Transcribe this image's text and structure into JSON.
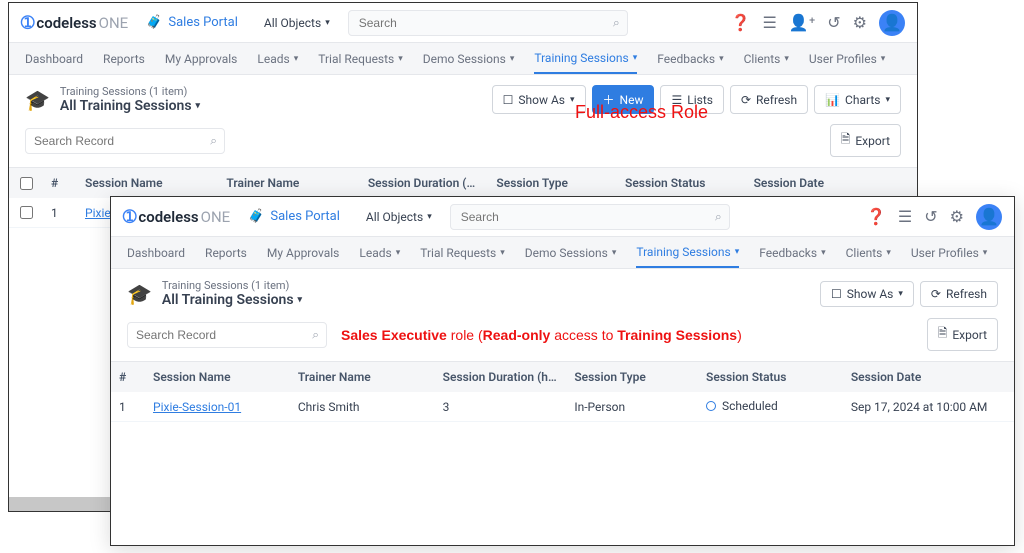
{
  "brand": {
    "codeless": "codeless",
    "one": "ONE"
  },
  "portal": "Sales Portal",
  "objects_selector": "All Objects",
  "search_placeholder": "Search",
  "nav": {
    "dashboard": "Dashboard",
    "reports": "Reports",
    "approvals": "My Approvals",
    "leads": "Leads",
    "trial": "Trial Requests",
    "demo": "Demo Sessions",
    "training": "Training Sessions",
    "feedbacks": "Feedbacks",
    "clients": "Clients",
    "profiles": "User Profiles"
  },
  "list": {
    "breadcrumb": "Training Sessions (1 item)",
    "title": "All Training Sessions",
    "search_placeholder": "Search Record"
  },
  "buttons": {
    "showas": "Show As",
    "new": "New",
    "lists": "Lists",
    "refresh": "Refresh",
    "charts": "Charts",
    "export": "Export"
  },
  "columns": {
    "idx": "#",
    "name": "Session Name",
    "trainer": "Trainer Name",
    "dur": "Session Duration (hou",
    "type": "Session Type",
    "status": "Session Status",
    "date": "Session Date"
  },
  "row": {
    "idx": "1",
    "name": "Pixie-Session-01",
    "trainer": "Chris Smith",
    "dur": "3",
    "type": "In-Person",
    "status": "Scheduled",
    "date_short": "Sep 17, 2024 at 10",
    "date_full": "Sep 17, 2024 at 10:00 AM"
  },
  "annot": {
    "top": "Full-access Role",
    "bottom_1": "Sales Executive",
    "bottom_2": " role (",
    "bottom_3": "Read-only",
    "bottom_4": " access to ",
    "bottom_5": "Training Sessions",
    "bottom_6": ")"
  }
}
